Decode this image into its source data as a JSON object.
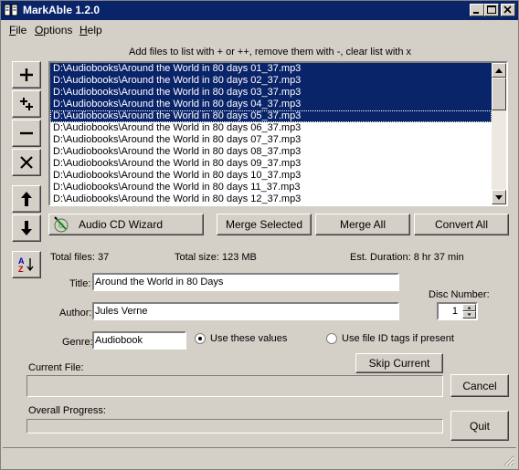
{
  "window": {
    "title": "MarkAble 1.2.0"
  },
  "menu": [
    {
      "key": "F",
      "rest": "ile"
    },
    {
      "key": "O",
      "rest": "ptions"
    },
    {
      "key": "H",
      "rest": "elp"
    }
  ],
  "hint": "Add files to list with + or ++, remove them with -, clear list with x",
  "files": [
    {
      "path": "D:\\Audiobooks\\Around the World in 80 days 01_37.mp3",
      "selected": true
    },
    {
      "path": "D:\\Audiobooks\\Around the World in 80 days 02_37.mp3",
      "selected": true
    },
    {
      "path": "D:\\Audiobooks\\Around the World in 80 days 03_37.mp3",
      "selected": true
    },
    {
      "path": "D:\\Audiobooks\\Around the World in 80 days 04_37.mp3",
      "selected": true
    },
    {
      "path": "D:\\Audiobooks\\Around the World in 80 days 05_37.mp3",
      "selected": true
    },
    {
      "path": "D:\\Audiobooks\\Around the World in 80 days 06_37.mp3",
      "selected": false
    },
    {
      "path": "D:\\Audiobooks\\Around the World in 80 days 07_37.mp3",
      "selected": false
    },
    {
      "path": "D:\\Audiobooks\\Around the World in 80 days 08_37.mp3",
      "selected": false
    },
    {
      "path": "D:\\Audiobooks\\Around the World in 80 days 09_37.mp3",
      "selected": false
    },
    {
      "path": "D:\\Audiobooks\\Around the World in 80 days 10_37.mp3",
      "selected": false
    },
    {
      "path": "D:\\Audiobooks\\Around the World in 80 days 11_37.mp3",
      "selected": false
    },
    {
      "path": "D:\\Audiobooks\\Around the World in 80 days 12_37.mp3",
      "selected": false
    }
  ],
  "buttons": {
    "wizard": "Audio CD Wizard",
    "merge_selected": "Merge Selected",
    "merge_all": "Merge All",
    "convert_all": "Convert All",
    "skip_current": "Skip Current",
    "cancel": "Cancel",
    "quit": "Quit"
  },
  "stats": {
    "total_files": "Total files: 37",
    "total_size": "Total size: 123 MB",
    "duration": "Est. Duration: 8 hr 37 min"
  },
  "form": {
    "title_label": "Title:",
    "title_value": "Around the World in 80 Days",
    "author_label": "Author:",
    "author_value": "Jules Verne",
    "genre_label": "Genre:",
    "genre_value": "Audiobook",
    "disc_label": "Disc Number:",
    "disc_value": "1",
    "radio_use_values": "Use these values",
    "radio_use_tags": "Use file ID tags if present"
  },
  "progress": {
    "current_label": "Current File:",
    "current_value": 0,
    "overall_label": "Overall Progress:",
    "overall_value": 0
  },
  "colors": {
    "selection": "#0a246a",
    "face": "#d4d0c8"
  }
}
